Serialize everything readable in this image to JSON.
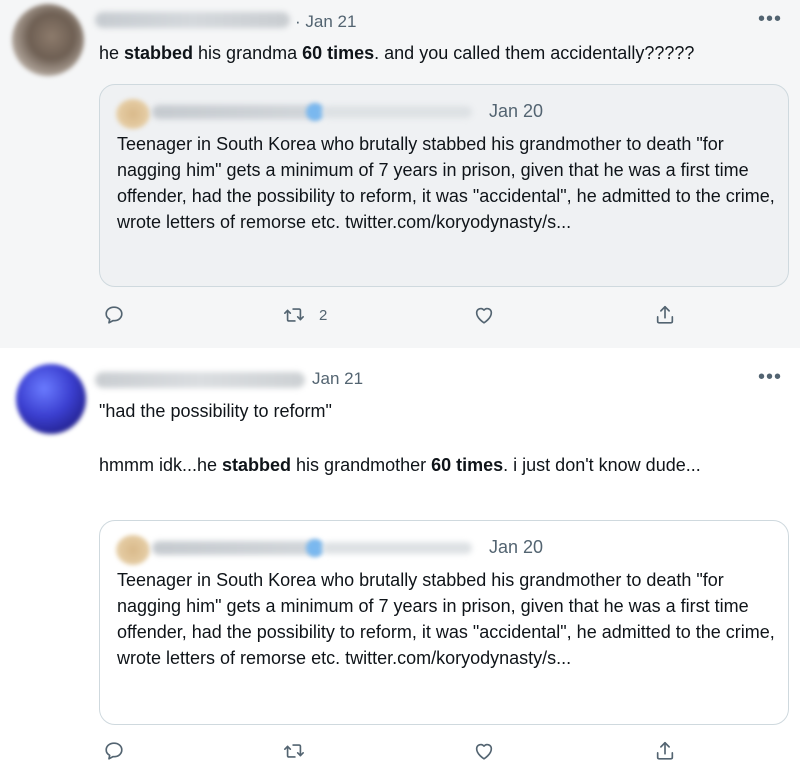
{
  "tweets": [
    {
      "date": "· Jan 21",
      "more": "•••",
      "text": {
        "p1": "he ",
        "b1": "stabbed",
        "p2": " his grandma ",
        "b2": "60 times",
        "p3": ". and you called them accidentally?????"
      },
      "quote": {
        "date": "Jan 20",
        "text": "Teenager in South Korea who brutally stabbed his grandmother to death \"for nagging him\" gets a minimum of 7 years in prison, given that he was a first time offender, had the possibility to reform, it was \"accidental\", he admitted to the crime, wrote letters of remorse etc. twitter.com/koryodynasty/s..."
      },
      "actions": {
        "retweet_count": "2"
      }
    },
    {
      "date": "Jan 21",
      "more": "•••",
      "line1": "\"had the possibility to reform\"",
      "text": {
        "p1": "hmmm idk...he ",
        "b1": "stabbed",
        "p2": " his grandmother ",
        "b2": "60 times",
        "p3": ". i just don't know dude..."
      },
      "quote": {
        "date": "Jan 20",
        "text": "Teenager in South Korea who brutally stabbed his grandmother to death \"for nagging him\" gets a minimum of 7 years in prison, given that he was a first time offender, had the possibility to reform, it was \"accidental\", he admitted to the crime, wrote letters of remorse etc. twitter.com/koryodynasty/s..."
      },
      "actions": {
        "retweet_count": ""
      }
    }
  ]
}
